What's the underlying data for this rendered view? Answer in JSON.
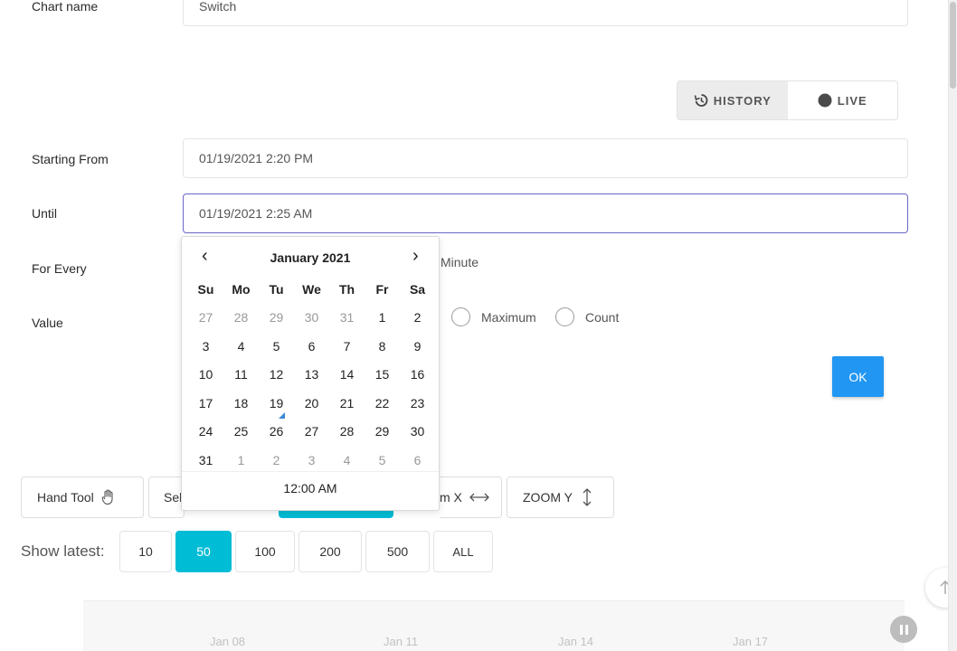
{
  "form": {
    "chart_name_label": "Chart name",
    "chart_name_value": "Switch",
    "starting_from_label": "Starting From",
    "starting_from_value": "01/19/2021 2:20 PM",
    "until_label": "Until",
    "until_value": "01/19/2021 2:25 AM",
    "for_every_label": "For Every",
    "for_every_unit": "Minute",
    "value_label": "Value",
    "value_options": [
      "Maximum",
      "Count"
    ],
    "ok_label": "OK"
  },
  "mode_toggle": {
    "history_label": "HISTORY",
    "live_label": "LIVE",
    "active": "history"
  },
  "calendar": {
    "prev_icon": "‹",
    "next_icon": "›",
    "month_title": "January 2021",
    "weekdays": [
      "Su",
      "Mo",
      "Tu",
      "We",
      "Th",
      "Fr",
      "Sa"
    ],
    "weeks": [
      [
        "27",
        "28",
        "29",
        "30",
        "31",
        "1",
        "2"
      ],
      [
        "3",
        "4",
        "5",
        "6",
        "7",
        "8",
        "9"
      ],
      [
        "10",
        "11",
        "12",
        "13",
        "14",
        "15",
        "16"
      ],
      [
        "17",
        "18",
        "19",
        "20",
        "21",
        "22",
        "23"
      ],
      [
        "24",
        "25",
        "26",
        "27",
        "28",
        "29",
        "30"
      ],
      [
        "31",
        "1",
        "2",
        "3",
        "4",
        "5",
        "6"
      ]
    ],
    "today": "19",
    "time": "12:00 AM"
  },
  "toolbar": {
    "hand_tool_label": "Hand Tool",
    "select_label_partial": "Sel",
    "zoom_x_label_partial": "m X",
    "zoom_y_label": "ZOOM Y"
  },
  "show_latest": {
    "label": "Show latest:",
    "options": [
      "10",
      "50",
      "100",
      "200",
      "500",
      "ALL"
    ],
    "active": "50"
  },
  "chart": {
    "x_ticks": [
      "Jan 08",
      "Jan 11",
      "Jan 14",
      "Jan 17"
    ]
  },
  "colors": {
    "accent_teal": "#00bcd4",
    "ok_blue": "#2196f3",
    "focus_border": "#6b66c7",
    "today_marker": "#3a8ad6"
  }
}
